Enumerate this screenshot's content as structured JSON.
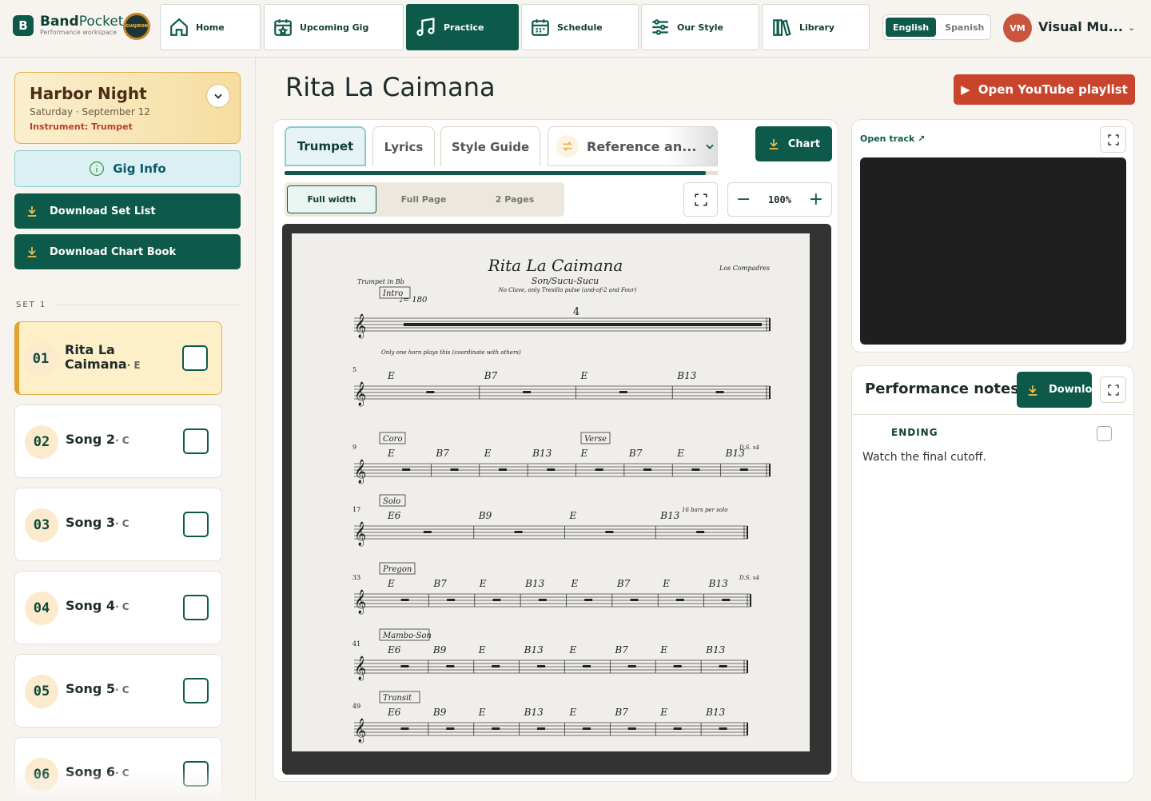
{
  "brand": {
    "mark": "B",
    "name_a": "Band",
    "name_b": "Pocket",
    "subtitle": "Performance workspace",
    "logo_text": "GUAJIRON"
  },
  "nav": [
    "Home",
    "Upcoming Gig",
    "Practice",
    "Schedule",
    "Our Style",
    "Library"
  ],
  "nav_active": "Practice",
  "language": {
    "options": [
      "English",
      "Spanish"
    ],
    "selected": "English"
  },
  "user": {
    "initials": "VM",
    "name": "Visual Mu..."
  },
  "gig": {
    "title": "Harbor Night",
    "date": "Saturday · September 12",
    "instrument": "Instrument: Trumpet"
  },
  "sidebar_buttons": {
    "info": "Gig Info",
    "setlist": "Download Set List",
    "chartbook": "Download Chart Book"
  },
  "set_label": "SET 1",
  "songs": [
    {
      "num": "01",
      "title": "Rita La Caimana",
      "key": "· E",
      "active": true
    },
    {
      "num": "02",
      "title": "Song 2",
      "key": "· C"
    },
    {
      "num": "03",
      "title": "Song 3",
      "key": "· C"
    },
    {
      "num": "04",
      "title": "Song 4",
      "key": "· C"
    },
    {
      "num": "05",
      "title": "Song 5",
      "key": "· C"
    },
    {
      "num": "06",
      "title": "Song 6",
      "key": "· C"
    }
  ],
  "page_title": "Rita La Caimana",
  "youtube_button": "Open YouTube playlist",
  "tabs": {
    "trumpet": "Trumpet",
    "lyrics": "Lyrics",
    "style": "Style Guide",
    "reference": "Reference an..."
  },
  "chart_button": "Chart",
  "view_modes": [
    "Full width",
    "Full Page",
    "2 Pages"
  ],
  "view_selected": "Full width",
  "zoom": "100%",
  "sheet": {
    "title": "Rita La Caimana",
    "subtitle": "Son/Sucu-Sucu",
    "note": "No Clave, only Tresillo pulse (and-of-2 and Four)",
    "composer": "Los Compadres",
    "instrument": "Trumpet in Bb",
    "tempo": "♩= 180",
    "rows": [
      {
        "label": "Intro",
        "bar": "",
        "chords": [],
        "remark": "",
        "rest": "4"
      },
      {
        "label": "",
        "bar": "5",
        "chords": [
          "E",
          "B7",
          "E",
          "B13"
        ],
        "remark": "Only one horn plays this (coordinate with others)"
      },
      {
        "label": "Coro",
        "bar": "9",
        "chords": [
          "E",
          "B7",
          "E",
          "B13",
          "E",
          "B7",
          "E",
          "B13"
        ],
        "remark": "D.S. x4",
        "label2": "Verse"
      },
      {
        "label": "Solo",
        "bar": "17",
        "chords": [
          "E6",
          "B9",
          "E",
          "B13"
        ],
        "remark": "16 bars per solo"
      },
      {
        "label": "Pregon",
        "bar": "33",
        "chords": [
          "E",
          "B7",
          "E",
          "B13",
          "E",
          "B7",
          "E",
          "B13"
        ],
        "remark": "D.S. x4"
      },
      {
        "label": "Mambo-Son",
        "bar": "41",
        "chords": [
          "E6",
          "B9",
          "E",
          "B13",
          "E",
          "B7",
          "E",
          "B13"
        ],
        "remark": ""
      },
      {
        "label": "Transit",
        "bar": "49",
        "chords": [
          "E6",
          "B9",
          "E",
          "B13",
          "E",
          "B7",
          "E",
          "B13"
        ],
        "remark": ""
      }
    ]
  },
  "track": {
    "open_label": "Open track ↗"
  },
  "notes": {
    "title": "Performance notes",
    "download": "Download",
    "heading": "ENDING",
    "text": "Watch the final cutoff."
  },
  "colors": {
    "primary": "#0d5a4a",
    "accent": "#c8442b",
    "gold": "#e2b14e"
  }
}
